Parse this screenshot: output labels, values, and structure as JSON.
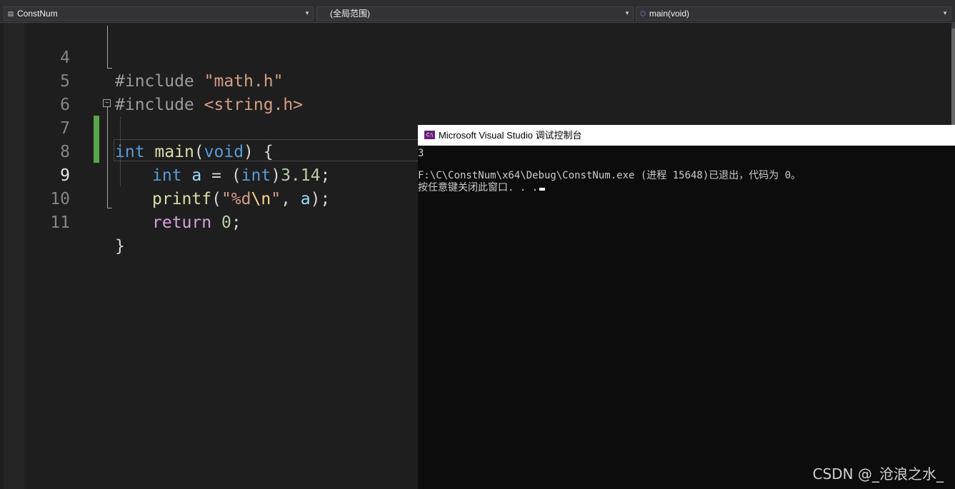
{
  "navbar": {
    "project": "ConstNum",
    "scope": "(全局范围)",
    "member": "main(void)"
  },
  "editor": {
    "line_numbers": [
      "4",
      "5",
      "6",
      "7",
      "8",
      "9",
      "10",
      "11"
    ],
    "current_line": "9",
    "code": {
      "l4": {
        "directive": "#include",
        "path": "\"math.h\""
      },
      "l5": {
        "directive": "#include",
        "path": "<string.h>"
      },
      "l7": {
        "type": "int",
        "fn": "main",
        "lparen": "(",
        "param": "void",
        "rparen": ")",
        "brace": " {"
      },
      "l8": {
        "type": "int",
        "var": "a",
        "eq": " = ",
        "lparen": "(",
        "cast": "int",
        "rparen": ")",
        "num": "3.14",
        "semi": ";"
      },
      "l9": {
        "fn": "printf",
        "lparen": "(",
        "str_a": "\"%d",
        "esc": "\\n",
        "str_b": "\"",
        "comma": ", ",
        "var": "a",
        "rparen": ")",
        "semi": ";"
      },
      "l10": {
        "kw": "return",
        "sp": " ",
        "num": "0",
        "semi": ";"
      },
      "l11": {
        "brace": "}"
      }
    }
  },
  "console": {
    "title": "Microsoft Visual Studio 调试控制台",
    "icon_text": "C:\\",
    "lines": [
      "3",
      "",
      "F:\\C\\ConstNum\\x64\\Debug\\ConstNum.exe (进程 15648)已退出，代码为 0。",
      "按任意键关闭此窗口. . ."
    ]
  },
  "watermark": "CSDN @_沧浪之水_",
  "colors": {
    "background": "#1e1e1e",
    "keyword": "#569cd6",
    "control_keyword": "#d8a0df",
    "function": "#dcdcaa",
    "string": "#d69d85",
    "number": "#b5cea8",
    "variable": "#9cdcfe",
    "change_marker": "#57a64a",
    "console_bg": "#0c0c0c"
  },
  "icons": {
    "project": "project-file-icon",
    "member": "cube-icon",
    "dropdown": "chevron-down-icon",
    "console": "console-app-icon"
  }
}
